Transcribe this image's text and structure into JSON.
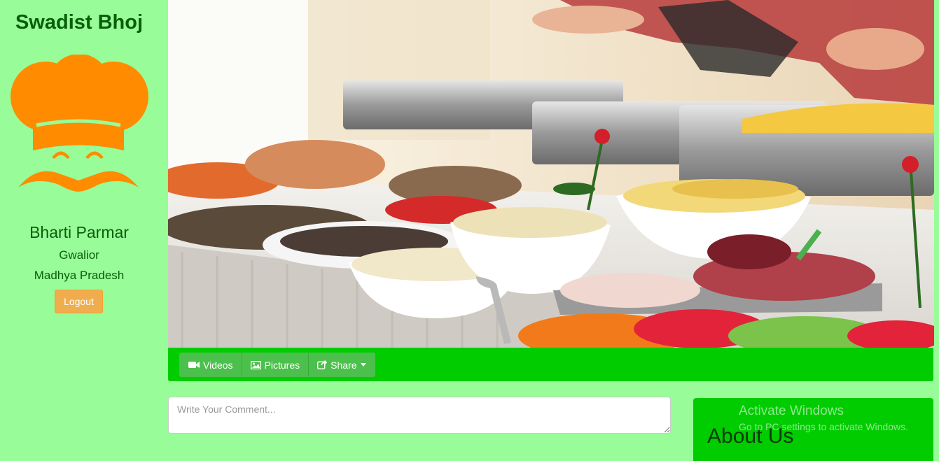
{
  "brand": {
    "name": "Swadist Bhoj",
    "logo_icon": "chef-logo-icon",
    "accent": "#ff8c00"
  },
  "profile": {
    "name": "Bharti Parmar",
    "city": "Gwalior",
    "state": "Madhya Pradesh",
    "logout_label": "Logout"
  },
  "toolbar": {
    "videos_label": "Videos",
    "pictures_label": "Pictures",
    "share_label": "Share"
  },
  "comment": {
    "placeholder": "Write Your Comment...",
    "value": ""
  },
  "about": {
    "title": "About Us",
    "text": ""
  },
  "watermark": {
    "title": "Activate Windows",
    "subtitle": "Go to PC settings to activate Windows."
  },
  "colors": {
    "page_bg": "#98fc98",
    "sidebar_text": "#0a5e0a",
    "toolbar_bg": "#00cc00",
    "logout_bg": "#f0ad4e"
  }
}
